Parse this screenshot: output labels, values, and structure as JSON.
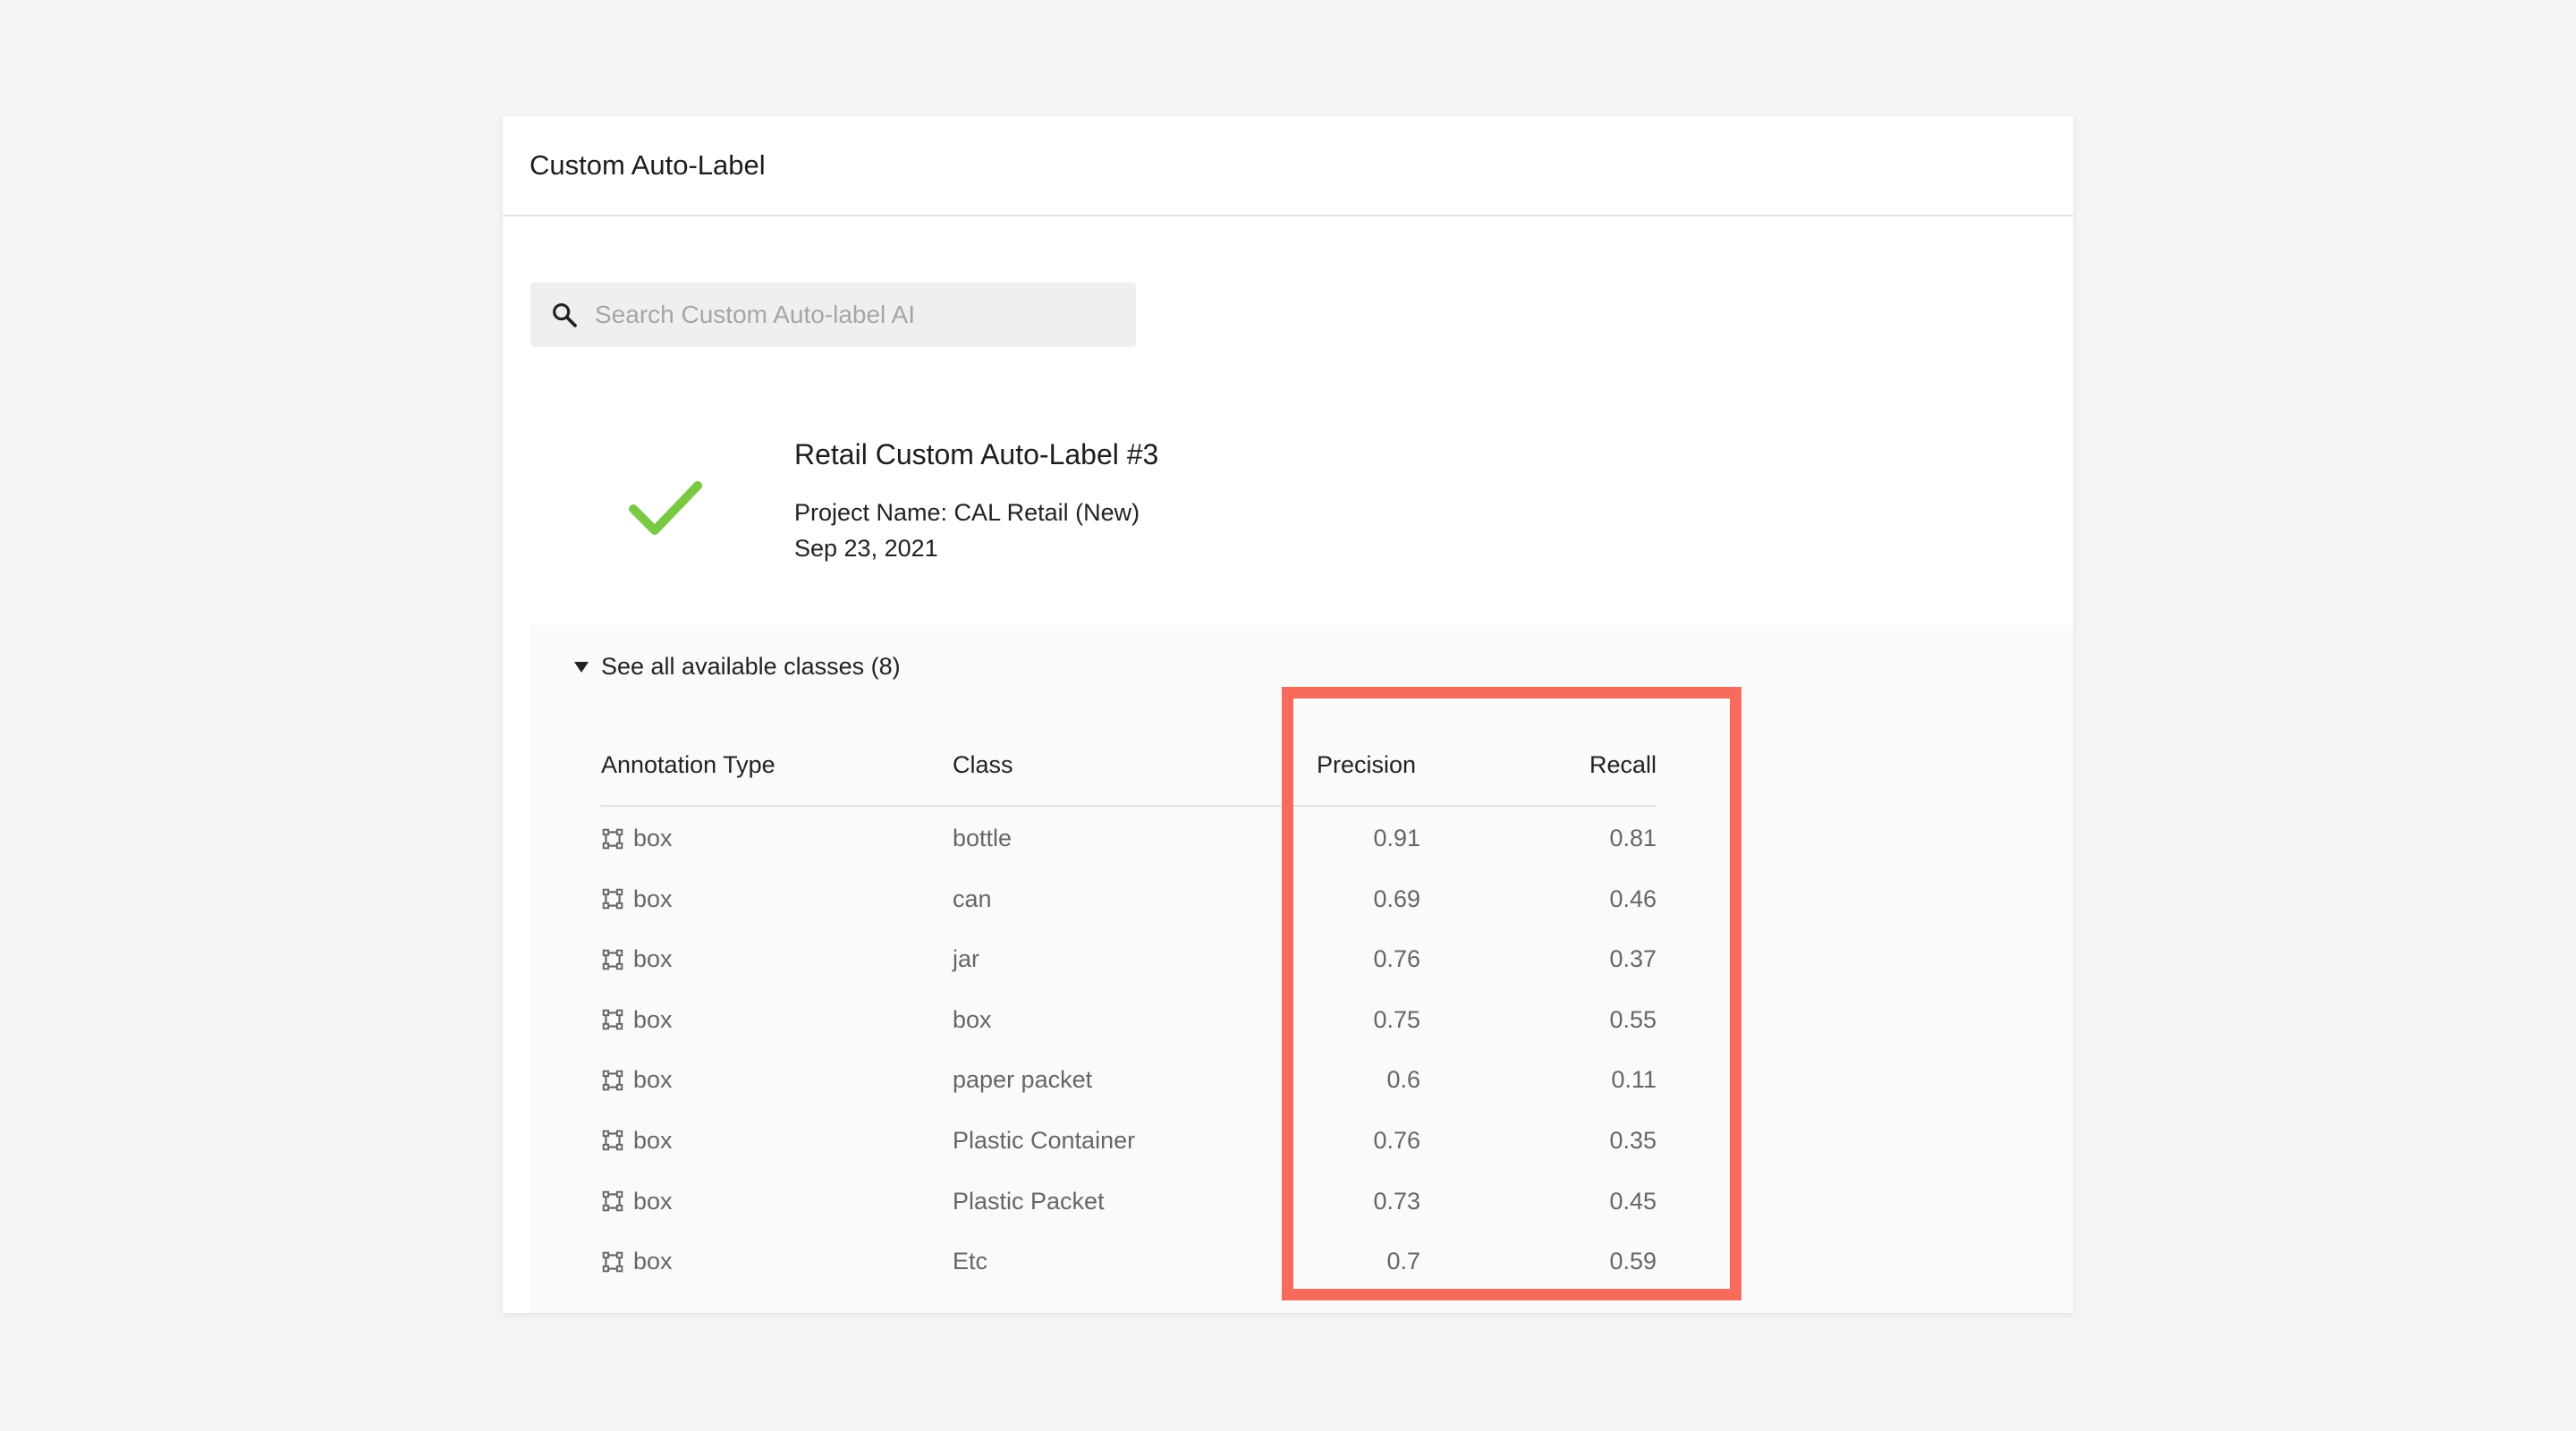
{
  "panel": {
    "title": "Custom Auto-Label"
  },
  "search": {
    "placeholder": "Search Custom Auto-label AI",
    "icon": "search-icon"
  },
  "model": {
    "title": "Retail Custom Auto-Label #3",
    "project": "Project Name: CAL Retail (New)",
    "date": "Sep 23, 2021",
    "status_icon": "check-icon",
    "status_color": "#7ac943"
  },
  "classes_toggle": {
    "label": "See all available classes (8)"
  },
  "table": {
    "headers": {
      "type": "Annotation Type",
      "class": "Class",
      "precision": "Precision",
      "recall": "Recall"
    },
    "rows": [
      {
        "type": "box",
        "class": "bottle",
        "precision": "0.91",
        "recall": "0.81"
      },
      {
        "type": "box",
        "class": "can",
        "precision": "0.69",
        "recall": "0.46"
      },
      {
        "type": "box",
        "class": "jar",
        "precision": "0.76",
        "recall": "0.37"
      },
      {
        "type": "box",
        "class": "box",
        "precision": "0.75",
        "recall": "0.55"
      },
      {
        "type": "box",
        "class": "paper packet",
        "precision": "0.6",
        "recall": "0.11"
      },
      {
        "type": "box",
        "class": "Plastic Container",
        "precision": "0.76",
        "recall": "0.35"
      },
      {
        "type": "box",
        "class": "Plastic Packet",
        "precision": "0.73",
        "recall": "0.45"
      },
      {
        "type": "box",
        "class": "Etc",
        "precision": "0.7",
        "recall": "0.59"
      }
    ]
  },
  "highlight": {
    "color": "#f76b5c"
  }
}
